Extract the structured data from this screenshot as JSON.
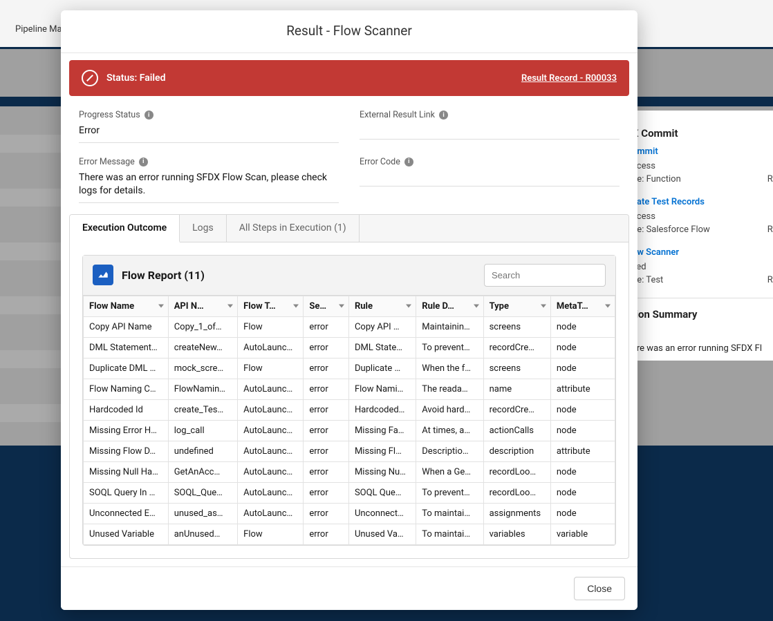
{
  "background": {
    "tab_label": "Pipeline Ma",
    "side": {
      "commit_title": "X Commit",
      "items": [
        {
          "title": "ommit",
          "status": "ccess",
          "type_label": "pe:",
          "type_value": "Function",
          "result": "Result"
        },
        {
          "title": "eate Test Records",
          "status": "ccess",
          "type_label": "pe:",
          "type_value": "Salesforce Flow",
          "result": "Result"
        },
        {
          "title": "ow Scanner",
          "status": "iled",
          "type_label": "pe:",
          "type_value": "Test",
          "result": "Result"
        }
      ],
      "summary_title": "tion Summary",
      "summary_error": "ere was an error running SFDX Fl"
    }
  },
  "modal": {
    "title": "Result - Flow Scanner",
    "status_label": "Status: Failed",
    "result_link": "Result Record - R00033",
    "fields": {
      "progress_status_label": "Progress Status",
      "progress_status_value": "Error",
      "external_link_label": "External Result Link",
      "external_link_value": "",
      "error_message_label": "Error Message",
      "error_message_value": "There was an error running SFDX Flow Scan, please check logs for details.",
      "error_code_label": "Error Code",
      "error_code_value": ""
    },
    "tabs": {
      "execution_outcome": "Execution Outcome",
      "logs": "Logs",
      "all_steps": "All Steps in Execution (1)"
    },
    "report": {
      "title": "Flow Report (11)",
      "search_placeholder": "Search",
      "columns": [
        "Flow Name",
        "API N…",
        "Flow T…",
        "Se…",
        "Rule",
        "Rule D…",
        "Type",
        "MetaT…"
      ],
      "rows": [
        [
          "Copy API Name",
          "Copy_1_of…",
          "Flow",
          "error",
          "Copy API …",
          "Maintainin…",
          "screens",
          "node"
        ],
        [
          "DML Statement…",
          "createNew…",
          "AutoLaunc…",
          "error",
          "DML State…",
          "To prevent…",
          "recordCre…",
          "node"
        ],
        [
          "Duplicate DML …",
          "mock_scre…",
          "Flow",
          "error",
          "Duplicate …",
          "When the f…",
          "screens",
          "node"
        ],
        [
          "Flow Naming C…",
          "FlowNamin…",
          "AutoLaunc…",
          "error",
          "Flow Nami…",
          "The reada…",
          "name",
          "attribute"
        ],
        [
          "Hardcoded Id",
          "create_Tes…",
          "AutoLaunc…",
          "error",
          "Hardcoded…",
          "Avoid hard…",
          "recordCre…",
          "node"
        ],
        [
          "Missing Error H…",
          "log_call",
          "AutoLaunc…",
          "error",
          "Missing Fa…",
          "At times, a…",
          "actionCalls",
          "node"
        ],
        [
          "Missing Flow D…",
          "undefined",
          "AutoLaunc…",
          "error",
          "Missing Fl…",
          "Descriptio…",
          "description",
          "attribute"
        ],
        [
          "Missing Null Ha…",
          "GetAnAcc…",
          "AutoLaunc…",
          "error",
          "Missing Nu…",
          "When a Ge…",
          "recordLoo…",
          "node"
        ],
        [
          "SOQL Query In …",
          "SOQL_Que…",
          "AutoLaunc…",
          "error",
          "SOQL Que…",
          "To prevent…",
          "recordLoo…",
          "node"
        ],
        [
          "Unconnected E…",
          "unused_as…",
          "AutoLaunc…",
          "error",
          "Unconnect…",
          "To maintai…",
          "assignments",
          "node"
        ],
        [
          "Unused Variable",
          "anUnused…",
          "Flow",
          "error",
          "Unused Va…",
          "To maintai…",
          "variables",
          "variable"
        ]
      ]
    },
    "close_label": "Close"
  }
}
